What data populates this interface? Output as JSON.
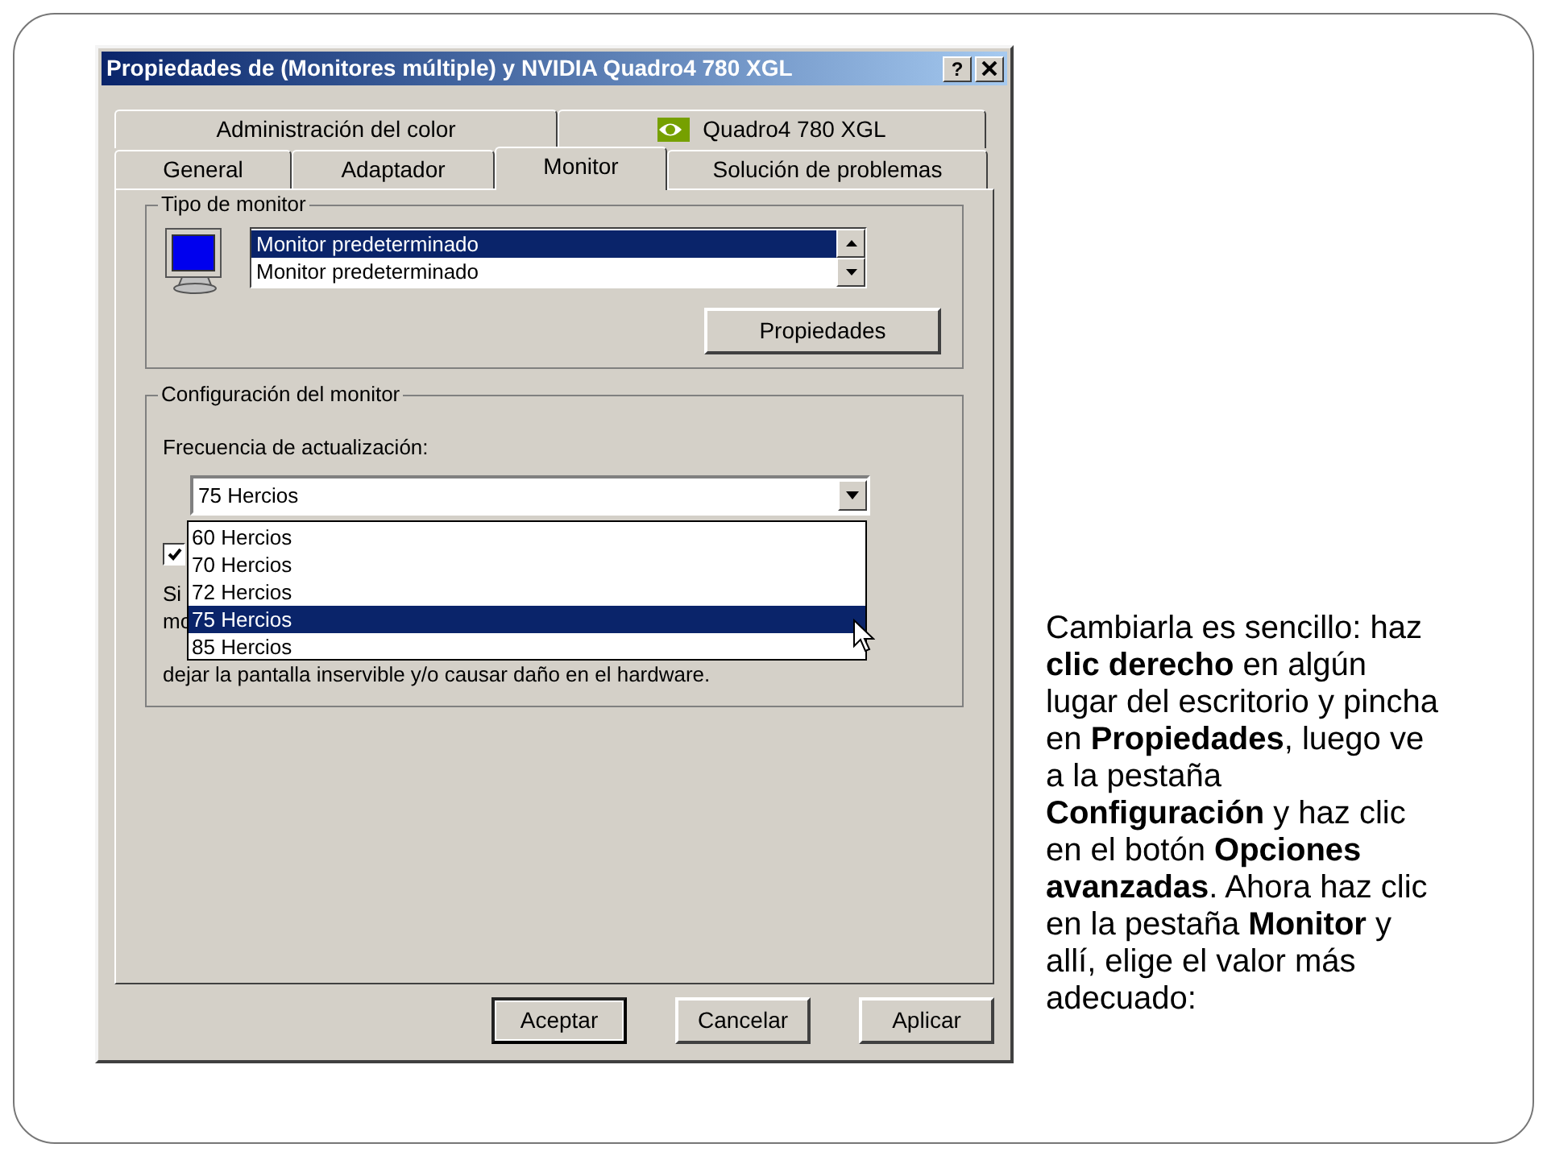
{
  "window": {
    "title": "Propiedades de (Monitores múltiple) y NVIDIA Quadro4 780 XGL",
    "help_button": "?"
  },
  "tabs": [
    [
      {
        "label": "Administración del color",
        "selected": false,
        "kind": "text"
      },
      {
        "label": "Quadro4 780 XGL",
        "selected": false,
        "kind": "vendor"
      }
    ],
    [
      {
        "label": "General",
        "selected": false,
        "kind": "text"
      },
      {
        "label": "Adaptador",
        "selected": false,
        "kind": "text"
      },
      {
        "label": "Monitor",
        "selected": true,
        "kind": "text"
      },
      {
        "label": "Solución de problemas",
        "selected": false,
        "kind": "text"
      }
    ]
  ],
  "monitor_type": {
    "title": "Tipo de monitor",
    "items": [
      {
        "label": "Monitor predeterminado",
        "selected": true
      },
      {
        "label": "Monitor predeterminado",
        "selected": false
      }
    ],
    "button": "Propiedades"
  },
  "monitor_settings": {
    "title": "Configuración del monitor",
    "refresh_label": "Frecuencia de actualización:",
    "value": "75 Hercios",
    "options": [
      {
        "label": "60 Hercios",
        "selected": false
      },
      {
        "label": "70 Hercios",
        "selected": false
      },
      {
        "label": "72 Hercios",
        "selected": false
      },
      {
        "label": "75 Hercios",
        "selected": true
      },
      {
        "label": "85 Hercios",
        "selected": false
      }
    ],
    "checkbox": {
      "checked": true
    },
    "note_fragments": [
      "Si",
      "mo"
    ],
    "note_last_line": "dejar la pantalla inservible y/o causar daño en el hardware."
  },
  "buttons": [
    {
      "label": "Aceptar",
      "default": true
    },
    {
      "label": "Cancelar",
      "default": false
    },
    {
      "label": "Aplicar",
      "default": false
    }
  ],
  "caption": "Cambiarla es sencillo: haz **clic derecho** en algún lugar del escritorio y pincha en **Propiedades**, luego ve a la pestaña **Configuración** y haz clic en el botón **Opciones avanzadas**. Ahora haz clic en la pestaña **Monitor** y allí, elige el valor más adecuado:"
}
